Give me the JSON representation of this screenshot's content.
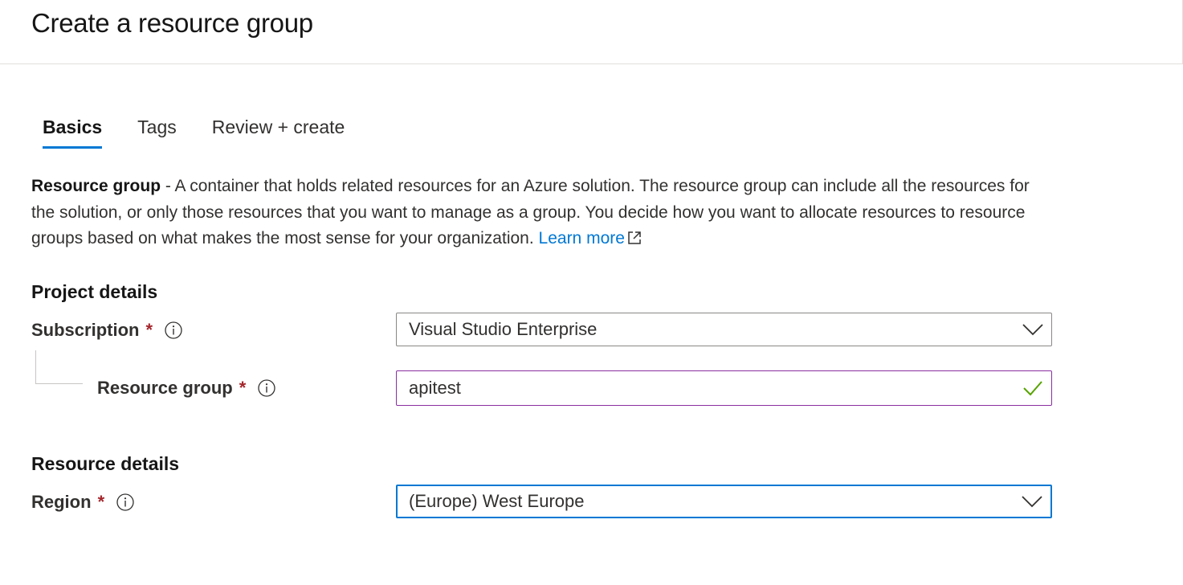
{
  "page": {
    "title": "Create a resource group"
  },
  "tabs": [
    {
      "label": "Basics",
      "active": true
    },
    {
      "label": "Tags",
      "active": false
    },
    {
      "label": "Review + create",
      "active": false
    }
  ],
  "description": {
    "bold": "Resource group",
    "text": " - A container that holds related resources for an Azure solution. The resource group can include all the resources for the solution, or only those resources that you want to manage as a group. You decide how you want to allocate resources to resource groups based on what makes the most sense for your organization. ",
    "link": "Learn more"
  },
  "project_details": {
    "title": "Project details",
    "subscription": {
      "label": "Subscription",
      "required_mark": "*",
      "value": "Visual Studio Enterprise"
    },
    "resource_group": {
      "label": "Resource group",
      "required_mark": "*",
      "value": "apitest",
      "valid": true
    }
  },
  "resource_details": {
    "title": "Resource details",
    "region": {
      "label": "Region",
      "required_mark": "*",
      "value": "(Europe) West Europe"
    }
  },
  "colors": {
    "accent": "#0078d4",
    "required": "#a4262c",
    "valid": "#57a300",
    "textbox_border": "#8a2ea1"
  },
  "icons": [
    "info-icon",
    "chevron-down-icon",
    "checkmark-icon",
    "external-link-icon"
  ]
}
